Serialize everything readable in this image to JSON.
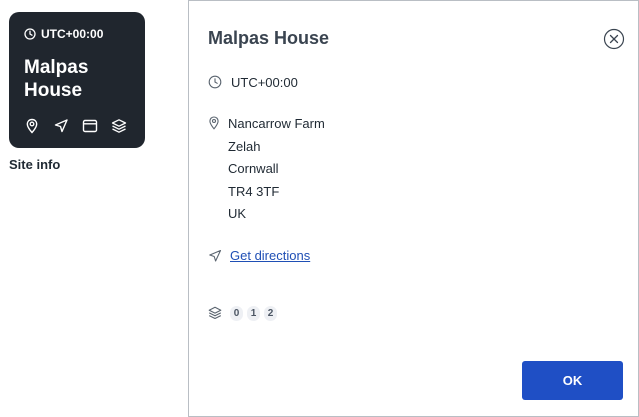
{
  "site_card": {
    "timezone": "UTC+00:00",
    "title": "Malpas House",
    "icons": [
      "clock-icon",
      "location-pin-icon",
      "navigation-arrow-icon",
      "browser-window-icon",
      "layers-icon"
    ],
    "background": "#20262e"
  },
  "site_info_label": "Site info",
  "dialog": {
    "title": "Malpas House",
    "timezone": "UTC+00:00",
    "address": {
      "line1": "Nancarrow Farm",
      "line2": "Zelah",
      "line3": "Cornwall",
      "line4": "TR4 3TF",
      "line5": "UK"
    },
    "directions_link": "Get directions",
    "layers": {
      "badge0": "0",
      "badge1": "1",
      "badge2": "2"
    },
    "ok_label": "OK",
    "accent_color": "#1f4fc5",
    "link_color": "#1f4fb5"
  }
}
